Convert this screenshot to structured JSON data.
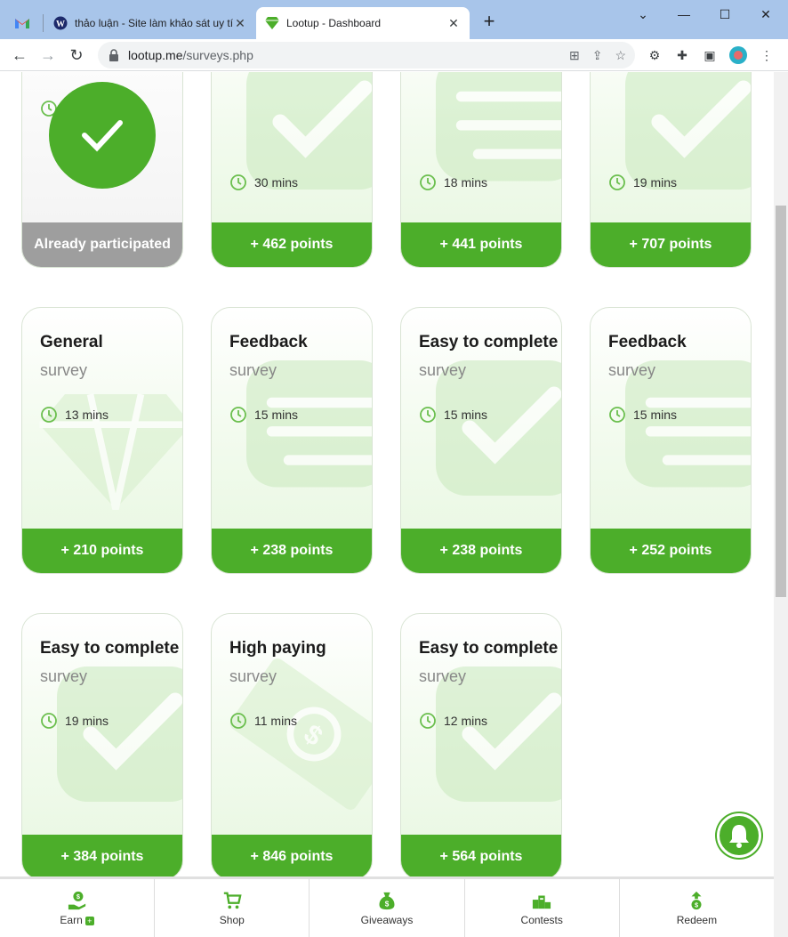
{
  "browser": {
    "tabs": [
      {
        "title": ""
      },
      {
        "title": "thảo luận - Site làm khảo sát uy tín"
      },
      {
        "title": "Lootup - Dashboard"
      }
    ],
    "url_domain": "lootup.me",
    "url_path": "/surveys.php"
  },
  "cards": [
    {
      "title": "",
      "sub": "",
      "time": "",
      "points": "Already participated",
      "done": true
    },
    {
      "title": "",
      "sub": "",
      "time": "30 mins",
      "points": "+ 462 points",
      "shape": "check"
    },
    {
      "title": "",
      "sub": "",
      "time": "18 mins",
      "points": "+ 441 points",
      "shape": "chat"
    },
    {
      "title": "",
      "sub": "",
      "time": "19 mins",
      "points": "+ 707 points",
      "shape": "check"
    },
    {
      "title": "General",
      "sub": "survey",
      "time": "13 mins",
      "points": "+ 210 points",
      "shape": "diamond"
    },
    {
      "title": "Feedback",
      "sub": "survey",
      "time": "15 mins",
      "points": "+ 238 points",
      "shape": "chat"
    },
    {
      "title": "Easy to complete",
      "sub": "survey",
      "time": "15 mins",
      "points": "+ 238 points",
      "shape": "check"
    },
    {
      "title": "Feedback",
      "sub": "survey",
      "time": "15 mins",
      "points": "+ 252 points",
      "shape": "chat"
    },
    {
      "title": "Easy to complete",
      "sub": "survey",
      "time": "19 mins",
      "points": "+ 384 points",
      "shape": "check"
    },
    {
      "title": "High paying",
      "sub": "survey",
      "time": "11 mins",
      "points": "+ 846 points",
      "shape": "money"
    },
    {
      "title": "Easy to complete",
      "sub": "survey",
      "time": "12 mins",
      "points": "+ 564 points",
      "shape": "check"
    }
  ],
  "bottom_nav": [
    {
      "label": "Earn",
      "icon": "earn-icon"
    },
    {
      "label": "Shop",
      "icon": "cart-icon"
    },
    {
      "label": "Giveaways",
      "icon": "money-bag-icon"
    },
    {
      "label": "Contests",
      "icon": "podium-icon"
    },
    {
      "label": "Redeem",
      "icon": "redeem-icon"
    }
  ],
  "colors": {
    "accent": "#4cae2a",
    "done": "#9e9e9e"
  }
}
